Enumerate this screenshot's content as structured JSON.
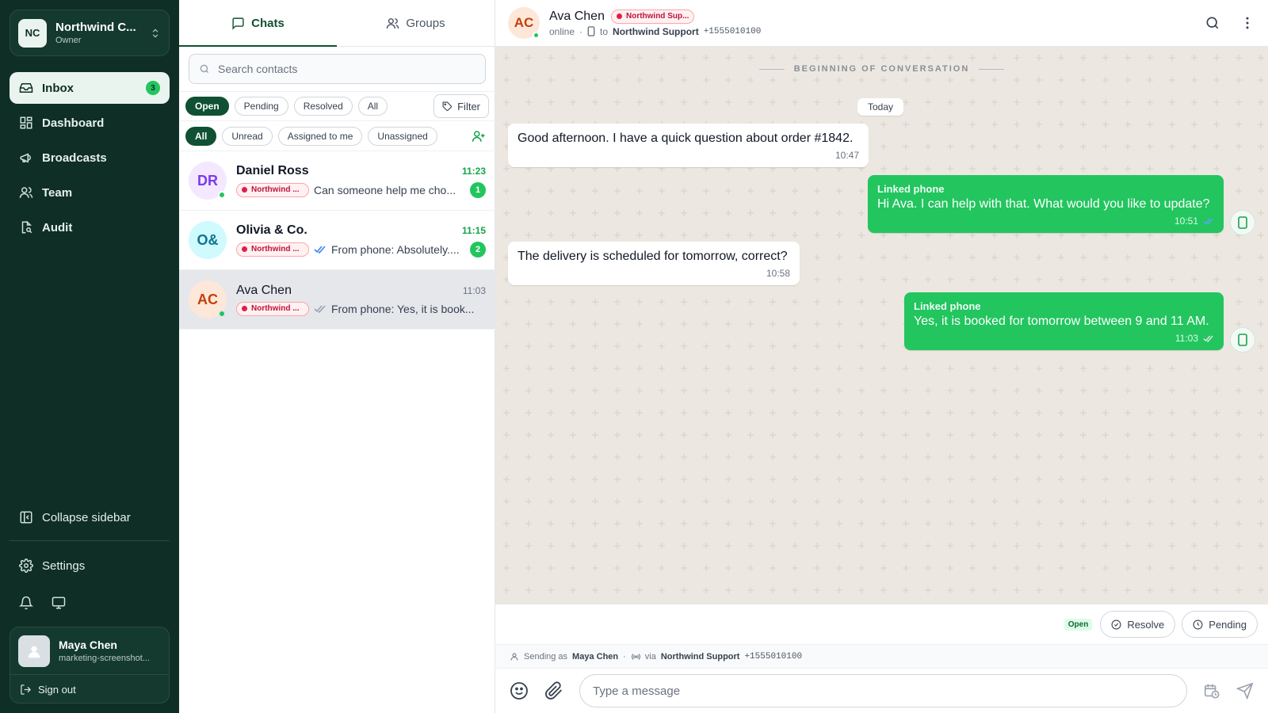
{
  "sidebar": {
    "org": {
      "initials": "NC",
      "name": "Northwind C...",
      "role": "Owner"
    },
    "nav": [
      {
        "label": "Inbox",
        "icon": "inbox-icon",
        "badge": "3",
        "active": true
      },
      {
        "label": "Dashboard",
        "icon": "dashboard-icon"
      },
      {
        "label": "Broadcasts",
        "icon": "megaphone-icon"
      },
      {
        "label": "Team",
        "icon": "team-icon"
      },
      {
        "label": "Audit",
        "icon": "audit-icon"
      }
    ],
    "collapse_label": "Collapse sidebar",
    "settings_label": "Settings",
    "user": {
      "name": "Maya Chen",
      "email": "marketing-screenshot..."
    },
    "signout_label": "Sign out"
  },
  "list": {
    "tabs": [
      {
        "label": "Chats",
        "active": true
      },
      {
        "label": "Groups"
      }
    ],
    "search_placeholder": "Search contacts",
    "status_filters": [
      "Open",
      "Pending",
      "Resolved",
      "All"
    ],
    "filter_label": "Filter",
    "assign_filters": [
      "All",
      "Unread",
      "Assigned to me",
      "Unassigned"
    ],
    "conversations": [
      {
        "initials": "DR",
        "name": "Daniel Ross",
        "time": "11:23",
        "tag": "Northwind ...",
        "preview": "Can someone help me cho...",
        "unread": "1",
        "online": true,
        "avatar_bg": "#f3e8ff",
        "avatar_fg": "#7c3aed"
      },
      {
        "initials": "O&",
        "name": "Olivia & Co.",
        "time": "11:15",
        "tag": "Northwind ...",
        "preview": "From phone: Absolutely....",
        "unread": "2",
        "online": false,
        "avatar_bg": "#cffafe",
        "avatar_fg": "#0e7490"
      },
      {
        "initials": "AC",
        "name": "Ava Chen",
        "time": "11:03",
        "tag": "Northwind ...",
        "preview": "From phone: Yes, it is book...",
        "online": true,
        "avatar_bg": "#fde7d9",
        "avatar_fg": "#c2410c"
      }
    ]
  },
  "header": {
    "initials": "AC",
    "name": "Ava Chen",
    "tag": "Northwind Sup...",
    "presence": "online",
    "to_label": "to",
    "channel": "Northwind Support",
    "number": "+1555010100"
  },
  "chat": {
    "beginning": "BEGINNING OF CONVERSATION",
    "date": "Today",
    "messages": [
      {
        "dir": "in",
        "text": "Good afternoon. I have a quick question about order #1842.",
        "time": "10:47"
      },
      {
        "dir": "out",
        "label": "Linked phone",
        "text": "Hi Ava. I can help with that. What would you like to update?",
        "time": "10:51"
      },
      {
        "dir": "in",
        "text": "The delivery is scheduled for tomorrow, correct?",
        "time": "10:58"
      },
      {
        "dir": "out",
        "label": "Linked phone",
        "text": "Yes, it is booked for tomorrow between 9 and 11 AM.",
        "time": "11:03"
      }
    ]
  },
  "status_bar": {
    "status": "Open",
    "resolve_label": "Resolve",
    "pending_label": "Pending"
  },
  "sending": {
    "prefix": "Sending as",
    "agent": "Maya Chen",
    "via": "via",
    "channel": "Northwind Support",
    "number": "+1555010100"
  },
  "composer": {
    "placeholder": "Type a message"
  },
  "colors": {
    "sidebar_bg": "#0f2e25",
    "accent": "#22c55e",
    "brand": "#0f5132",
    "chat_bg": "#ece8e1",
    "tag_red": "#e11d48"
  }
}
